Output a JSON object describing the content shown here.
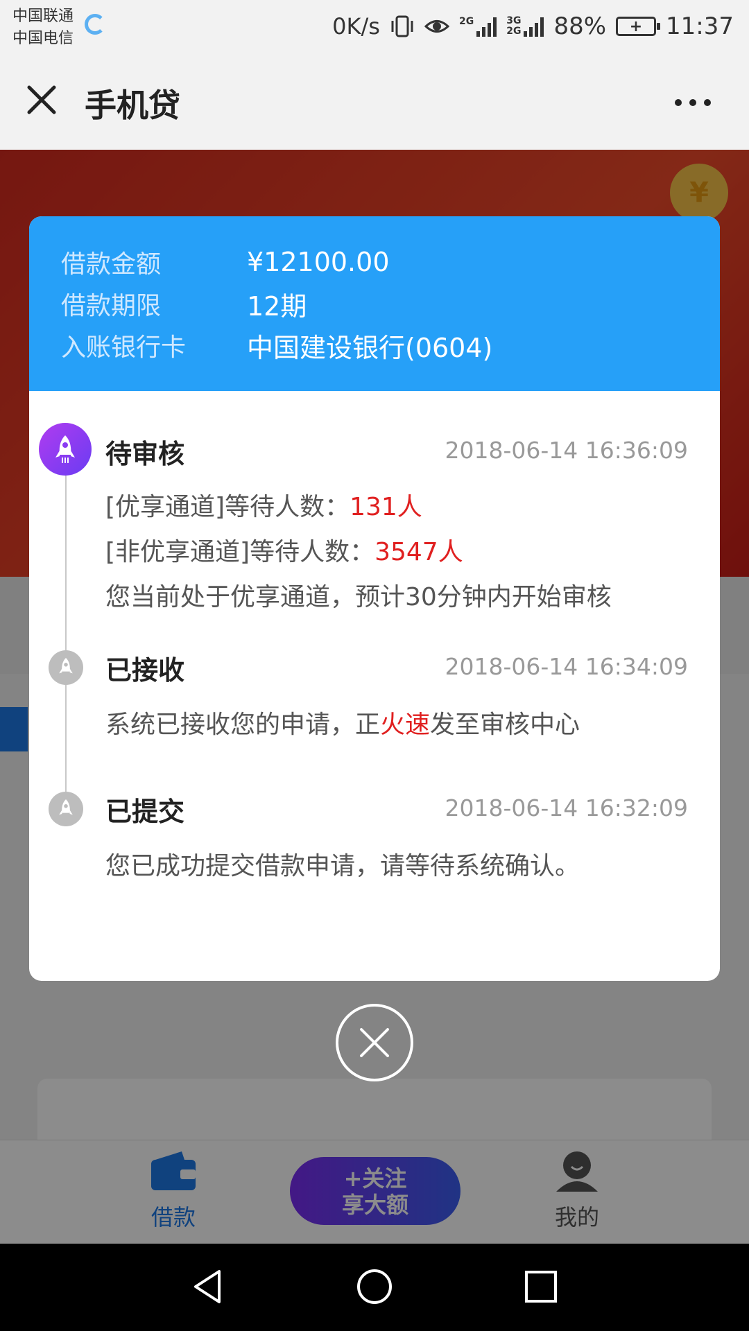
{
  "status_bar": {
    "carrier_1": "中国联通",
    "carrier_2": "中国电信",
    "net_speed": "0K/s",
    "net_2g": "2G",
    "net_3g": "3G",
    "net_2g_b": "2G",
    "battery": "88%",
    "time": "11:37"
  },
  "title_bar": {
    "title": "手机贷",
    "close_icon": "close-icon",
    "more_icon": "more-icon"
  },
  "modal": {
    "info": [
      {
        "label": "借款金额",
        "value": "¥12100.00"
      },
      {
        "label": "借款期限",
        "value": "12期"
      },
      {
        "label": "入账银行卡",
        "value": "中国建设银行(0604)"
      }
    ],
    "steps": [
      {
        "title": "待审核",
        "time": "2018-06-14 16:36:09",
        "line1_prefix": "[优享通道]等待人数：",
        "line1_value": "131人",
        "line2_prefix": "[非优享通道]等待人数：",
        "line2_value": "3547人",
        "line3": "您当前处于优享通道，预计30分钟内开始审核"
      },
      {
        "title": "已接收",
        "time": "2018-06-14 16:34:09",
        "line1_prefix": "系统已接收您的申请，正",
        "line1_highlight": "火速",
        "line1_suffix": "发至审核中心"
      },
      {
        "title": "已提交",
        "time": "2018-06-14 16:32:09",
        "line1": "您已成功提交借款申请，请等待系统确认。"
      }
    ]
  },
  "tab_bar": {
    "loan_label": "借款",
    "follow_line1": "+关注",
    "follow_line2": "享大额",
    "me_label": "我的"
  },
  "colors": {
    "header_blue": "#26a0f8",
    "highlight_red": "#e02020",
    "active_tab": "#1e78e6",
    "active_step": "#8a3cf2"
  }
}
